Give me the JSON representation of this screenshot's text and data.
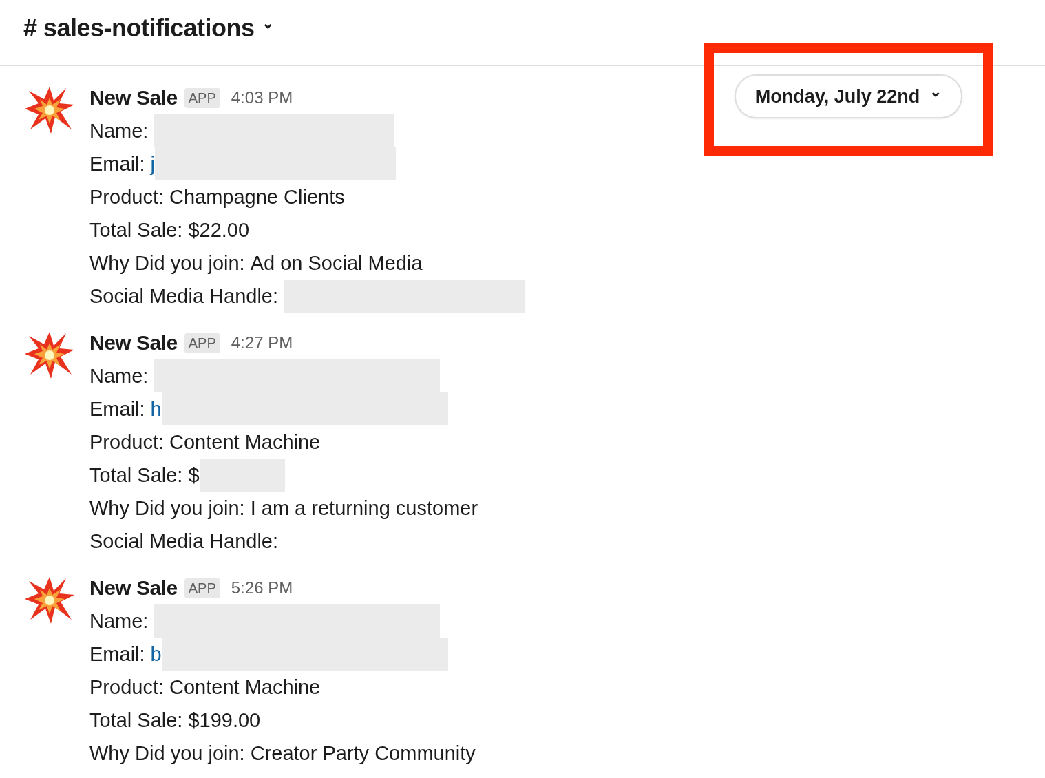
{
  "channel": {
    "name": "# sales-notifications",
    "caret": "⌄"
  },
  "date_divider": {
    "label": "Monday, July 22nd",
    "caret": "⌄",
    "highlighted": true
  },
  "messages": [
    {
      "sender": "New Sale",
      "badge": "APP",
      "time": "4:03 PM",
      "fields": [
        {
          "label": "Name:",
          "mask": {
            "kind": "medium"
          }
        },
        {
          "label": "Email:",
          "value": "j",
          "kind": "link",
          "mask": {
            "kind": "medium"
          }
        },
        {
          "label": "Product:",
          "value": "Champagne Clients",
          "kind": "text"
        },
        {
          "label": "Total Sale:",
          "value": "$22.00",
          "kind": "text"
        },
        {
          "label": "Why Did you join:",
          "value": "Ad on Social Media",
          "kind": "text"
        },
        {
          "label": "Social Media Handle:",
          "mask": {
            "kind": "medium"
          }
        }
      ]
    },
    {
      "sender": "New Sale",
      "badge": "APP",
      "time": "4:27 PM",
      "fields": [
        {
          "label": "Name:",
          "mask": {
            "kind": "wide"
          }
        },
        {
          "label": "Email:",
          "value": "h",
          "kind": "link",
          "mask": {
            "kind": "wide"
          }
        },
        {
          "label": "Product:",
          "value": "Content Machine",
          "kind": "text"
        },
        {
          "label": "Total Sale:",
          "value": "$",
          "kind": "text",
          "mask": {
            "kind": "short"
          }
        },
        {
          "label": "Why Did you join:",
          "value": "I am a returning customer",
          "kind": "text"
        },
        {
          "label": "Social Media Handle:"
        }
      ]
    },
    {
      "sender": "New Sale",
      "badge": "APP",
      "time": "5:26 PM",
      "fields": [
        {
          "label": "Name:",
          "mask": {
            "kind": "wide"
          }
        },
        {
          "label": "Email:",
          "value": "b",
          "kind": "link",
          "mask": {
            "kind": "wide"
          }
        },
        {
          "label": "Product:",
          "value": "Content Machine",
          "kind": "text"
        },
        {
          "label": "Total Sale:",
          "value": "$199.00",
          "kind": "text"
        },
        {
          "label": "Why Did you join:",
          "value": "Creator Party Community",
          "kind": "text"
        }
      ]
    }
  ]
}
